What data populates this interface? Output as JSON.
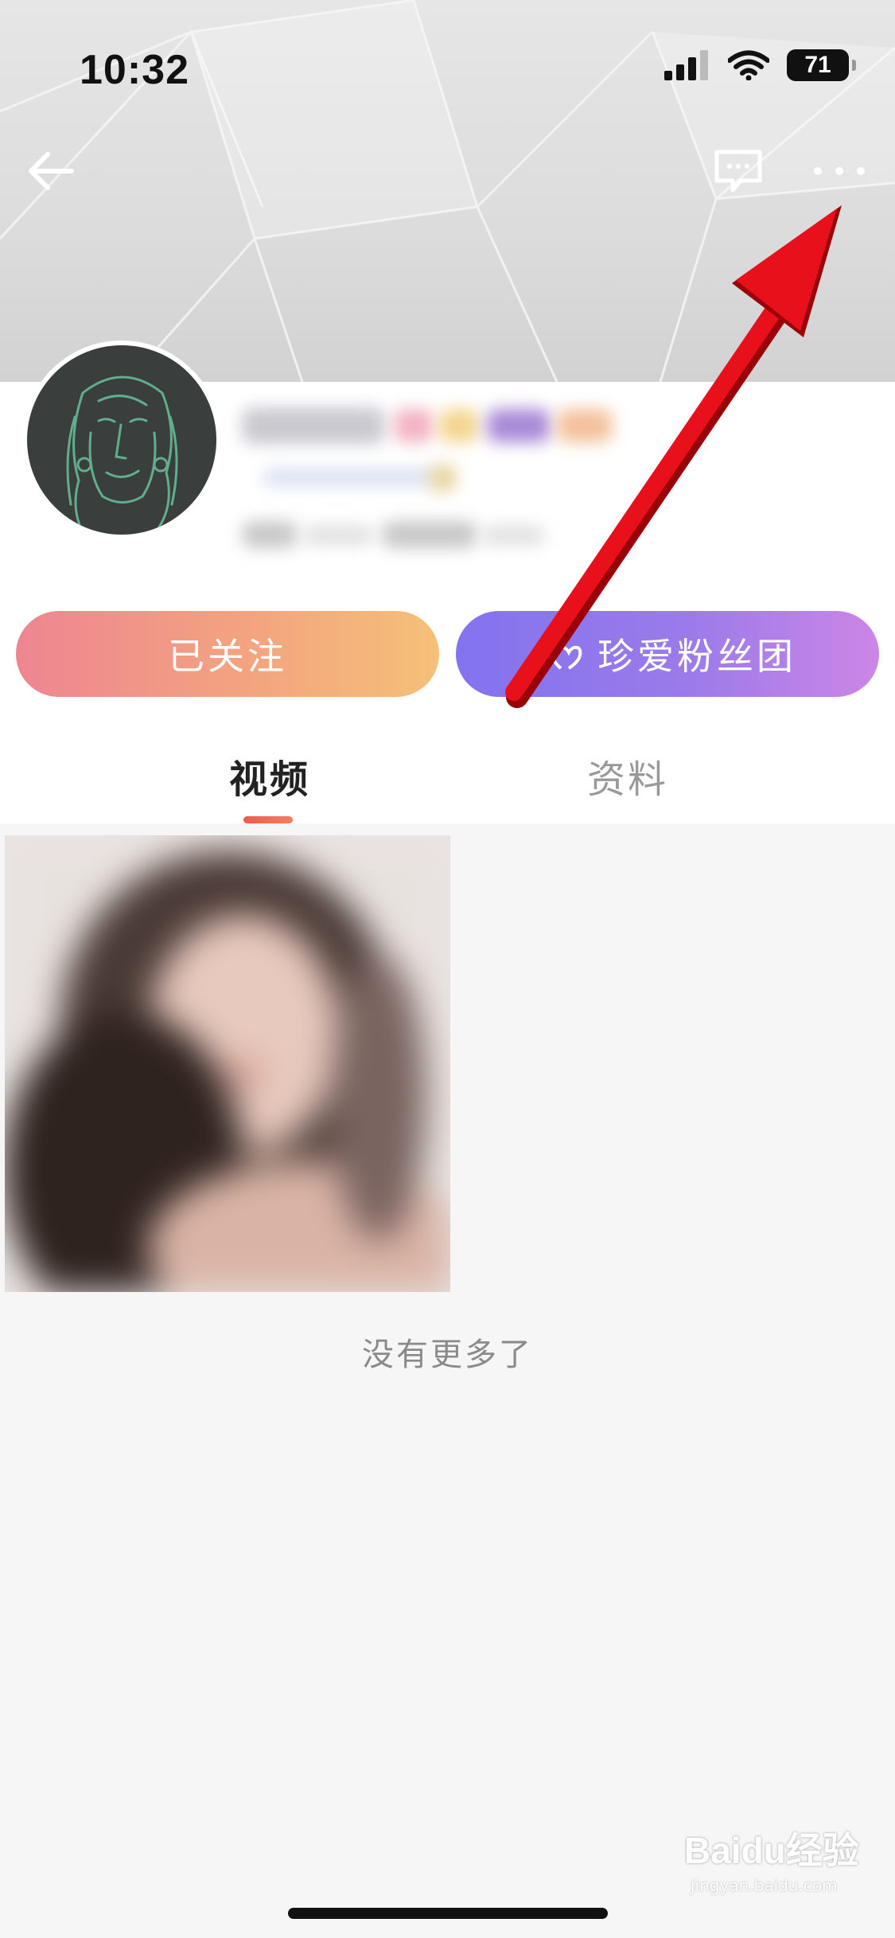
{
  "status_bar": {
    "time": "10:32",
    "battery": "71"
  },
  "nav": {
    "back_icon": "arrow-left-icon",
    "message_icon": "chat-bubble-icon",
    "more_icon": "more-dots-icon"
  },
  "profile": {
    "avatar_icon": "sketch-portrait-avatar"
  },
  "actions": {
    "follow_label": "已关注",
    "fans_label": "珍爱粉丝团"
  },
  "tabs": {
    "video": "视频",
    "info": "资料"
  },
  "content": {
    "end_text": "没有更多了"
  },
  "watermark": {
    "brand": "Baidu经验",
    "url": "jingyan.baidu.com"
  },
  "colors": {
    "follow_gradient": [
      "#ee8591",
      "#f5c078"
    ],
    "fans_gradient": [
      "#8273ef",
      "#cc86e6"
    ],
    "tab_indicator": "#f25a4a",
    "annotation_arrow": "#e8101a"
  }
}
